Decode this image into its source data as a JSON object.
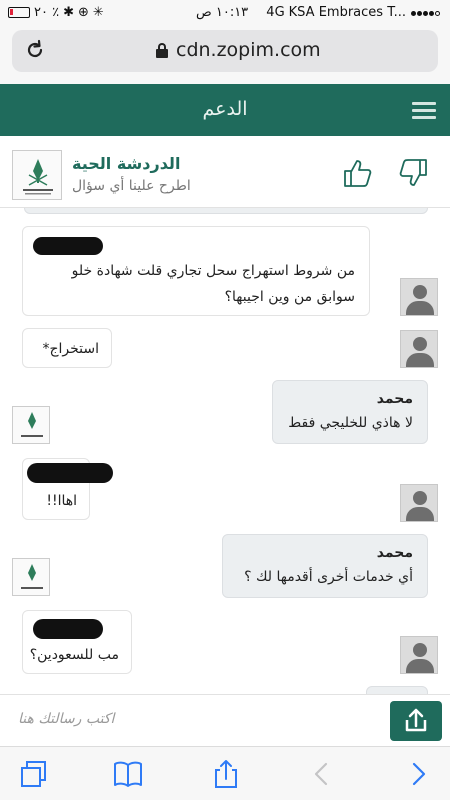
{
  "status_bar": {
    "carrier": "KSA Embraces T...",
    "network": "4G",
    "time": "١٠:١٣ ص",
    "battery_percent": "٢٠ ٪"
  },
  "browser": {
    "url": "cdn.zopim.com"
  },
  "app_header": {
    "title": "الدعم"
  },
  "agent_bar": {
    "name": "الدردشة الحية",
    "tagline": "اطرح علينا أي سؤال"
  },
  "messages": [
    {
      "sender": "visitor",
      "author": "",
      "text_line1": "من شروط استهراج سحل تجاري قلت شهادة خلو",
      "text_line2": "سوابق من وين اجيبها؟"
    },
    {
      "sender": "visitor",
      "author": "",
      "text": "استخراج*"
    },
    {
      "sender": "agent",
      "author": "محمد",
      "text": "لا هاذي للخليجي فقط"
    },
    {
      "sender": "visitor",
      "author": "",
      "text": "اهاا!!"
    },
    {
      "sender": "agent",
      "author": "محمد",
      "text": "أي خدمات أخرى أقدمها لك ؟"
    },
    {
      "sender": "visitor",
      "author": "",
      "text": "مب للسعودين؟"
    }
  ],
  "composer": {
    "placeholder": "اكتب رسالتك هنا"
  },
  "colors": {
    "brand": "#1f6b5c",
    "agent_bubble": "#eceff1",
    "ios_blue": "#2f7bf6"
  }
}
